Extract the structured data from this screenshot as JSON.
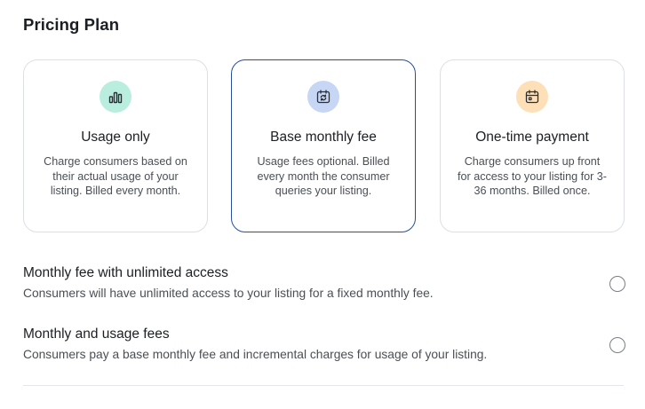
{
  "page": {
    "title": "Pricing Plan"
  },
  "colors": {
    "selected_border": "#264f9e",
    "card_border": "#dcdfe3",
    "usage_icon_bg": "#b9eedf",
    "base_icon_bg": "#c6d6f4",
    "onetime_icon_bg": "#fde0b8"
  },
  "cards": [
    {
      "icon": "bar-chart-icon",
      "title": "Usage only",
      "description": "Charge consumers based on their actual usage of your listing. Billed every month.",
      "selected": false
    },
    {
      "icon": "calendar-refresh-icon",
      "title": "Base monthly fee",
      "description": "Usage fees optional. Billed every month the consumer queries your listing.",
      "selected": true
    },
    {
      "icon": "calendar-icon",
      "title": "One-time payment",
      "description": "Charge consumers up front for access to your listing for 3-36 months. Billed once.",
      "selected": false
    }
  ],
  "options": [
    {
      "title": "Monthly fee with unlimited access",
      "description": "Consumers will have unlimited access to your listing for a fixed monthly fee.",
      "checked": false
    },
    {
      "title": "Monthly and usage fees",
      "description": "Consumers pay a base monthly fee and incremental charges for usage of your listing.",
      "checked": false
    }
  ]
}
